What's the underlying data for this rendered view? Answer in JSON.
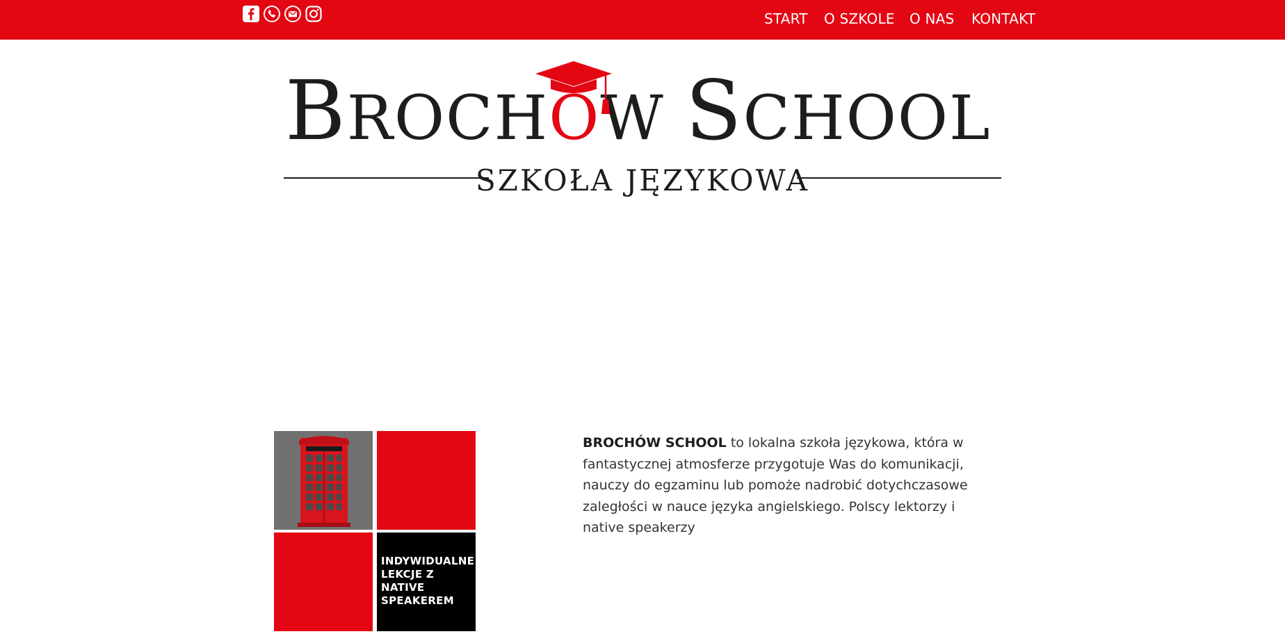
{
  "social": [
    {
      "name": "facebook-icon"
    },
    {
      "name": "phone-icon"
    },
    {
      "name": "email-icon"
    },
    {
      "name": "instagram-icon"
    }
  ],
  "nav": {
    "items": [
      "START",
      "O SZKOLE",
      "O NAS",
      "KONTAKT"
    ]
  },
  "logo": {
    "title_first": "B",
    "title_rest1": "ROCH",
    "title_o": "O",
    "title_rest2": "W ",
    "title_second": "S",
    "title_rest3": "CHOOL",
    "subtitle": "SZKOŁA JĘZYKOWA"
  },
  "tiles": {
    "black_text": "INDYWIDUALNE LEKCJE Z NATIVE SPEAKEREM"
  },
  "intro": {
    "brand": "BROCHÓW SCHOOL",
    "text": " to lokalna szkoła językowa, która w fantastycznej atmosferze przygotuje Was do komunikacji, nauczy do egzaminu lub pomoże nadrobić dotychczasowe zaległości w nauce języka angielskiego. Polscy lektorzy i native speakerzy"
  },
  "colors": {
    "brand_red": "#e30613",
    "dark": "#1d1d1b",
    "tile_gray": "#717171"
  }
}
